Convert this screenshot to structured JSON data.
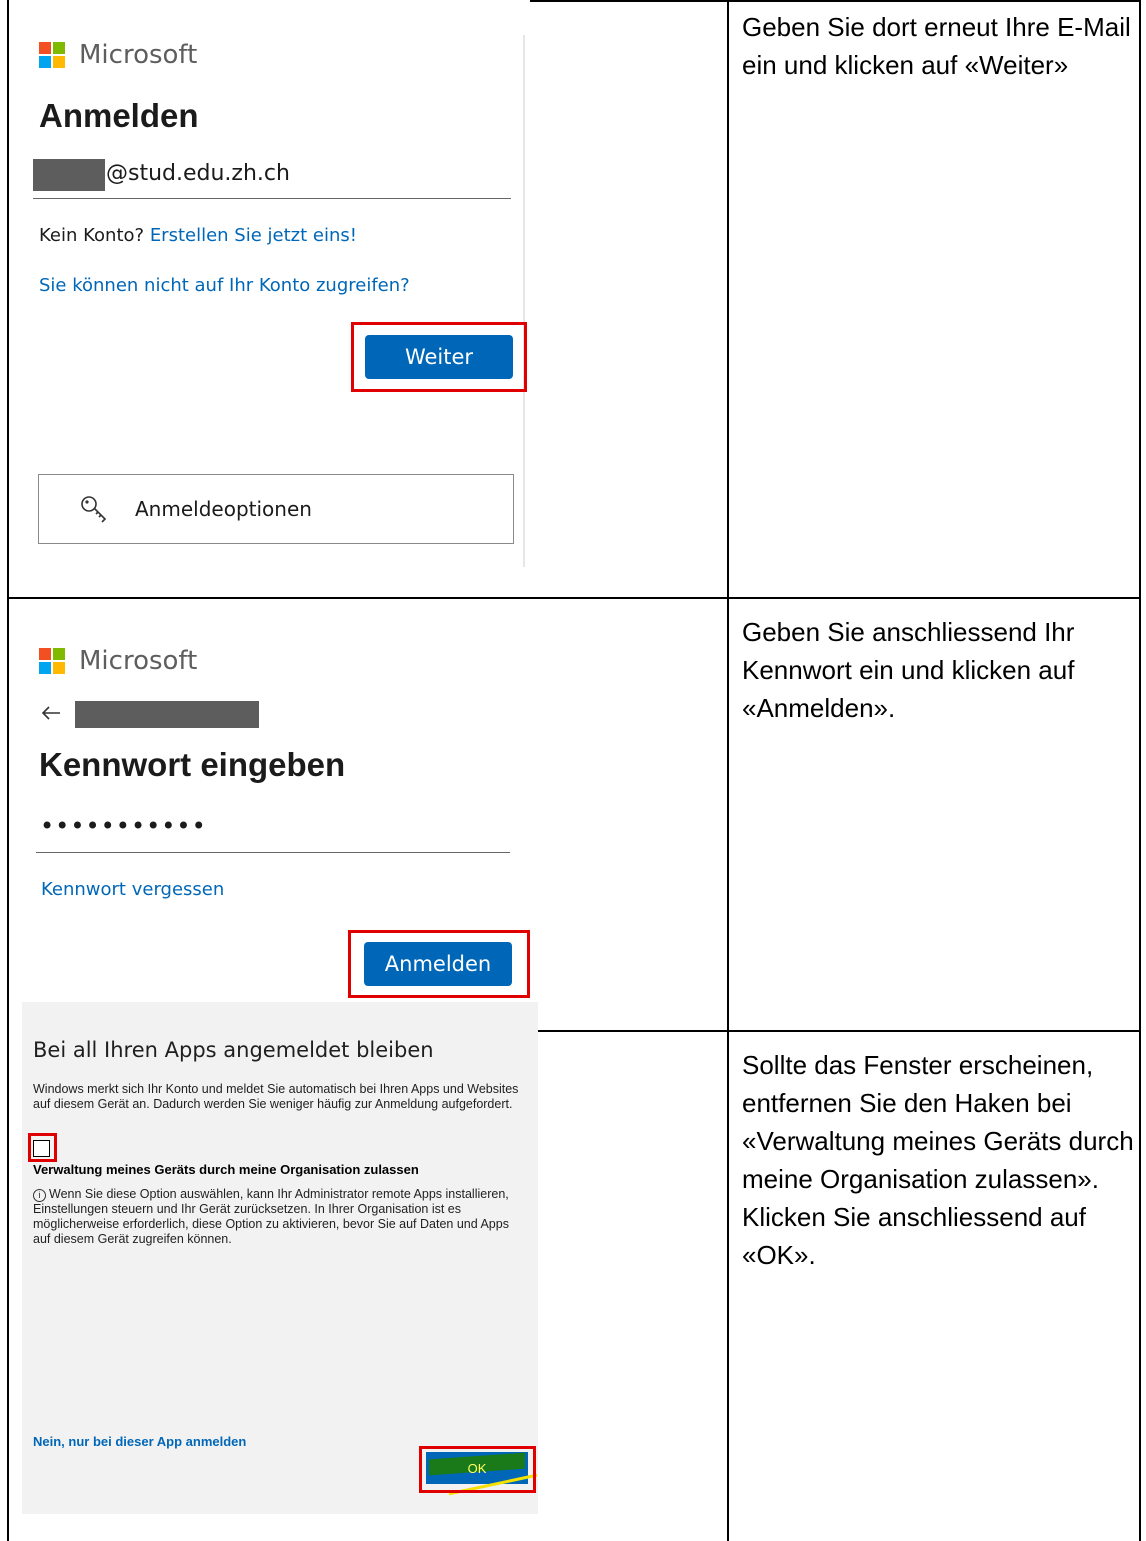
{
  "colors": {
    "microsoft_red": "#f25022",
    "microsoft_green": "#7fba00",
    "microsoft_blue": "#00a4ef",
    "microsoft_yellow": "#ffb900",
    "accent_blue": "#0067b8",
    "highlight_red": "#e00000"
  },
  "step1": {
    "logo_text": "Microsoft",
    "title": "Anmelden",
    "email_suffix": "@stud.edu.zh.ch",
    "no_account_text": "Kein Konto?",
    "create_link": "Erstellen Sie jetzt eins!",
    "cant_access_link": "Sie können nicht auf Ihr Konto zugreifen?",
    "next_button": "Weiter",
    "signin_options": "Anmeldeoptionen",
    "signin_options_icon": "key-icon",
    "description": "Geben Sie dort erneut Ihre E-Mail ein und klicken auf «Weiter»"
  },
  "step2": {
    "logo_text": "Microsoft",
    "back_icon": "back-arrow-icon",
    "title": "Kennwort eingeben",
    "password_mask": "•••••••••••",
    "forgot_link": "Kennwort vergessen",
    "signin_button": "Anmelden",
    "description": "Geben Sie anschliessend Ihr Kennwort ein und klicken auf «Anmelden»."
  },
  "step3": {
    "title": "Bei all Ihren Apps angemeldet bleiben",
    "body_line1": "Windows merkt sich Ihr Konto und meldet Sie automatisch bei Ihren Apps und Websites",
    "body_line2": "auf diesem Gerät an. Dadurch werden Sie weniger häufig zur Anmeldung aufgefordert.",
    "checkbox_label": "Verwaltung meines Geräts durch meine Organisation zulassen",
    "checkbox_checked": false,
    "info_icon": "info-icon",
    "info_line1": "Wenn Sie diese Option auswählen, kann Ihr Administrator remote Apps installieren,",
    "info_line2": "Einstellungen steuern und Ihr Gerät zurücksetzen. In Ihrer Organisation ist es",
    "info_line3": "möglicherweise erforderlich, diese Option zu aktivieren, bevor Sie auf Daten und Apps",
    "info_line4": "auf diesem Gerät zugreifen können.",
    "app_only_link": "Nein, nur bei dieser App anmelden",
    "ok_button": "OK",
    "description": "Sollte das Fenster erscheinen, entfernen Sie den Haken bei «Verwaltung meines Geräts durch meine Organisation zulassen». Klicken Sie anschliessend auf «OK»."
  }
}
